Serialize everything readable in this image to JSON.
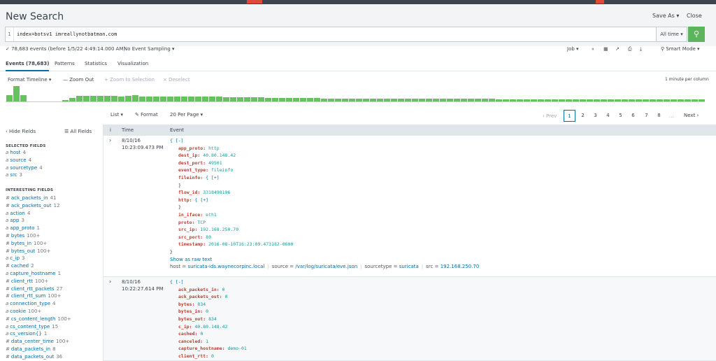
{
  "header": {
    "title": "New Search",
    "save_as": "Save As ▾",
    "close": "Close"
  },
  "search": {
    "line_number": "1",
    "query": "index=botsv1 imreallynotbatman.com",
    "time_range": "All time ▾",
    "go_icon": "search-icon"
  },
  "status": {
    "events_text": "✓ 78,683 events (before 1/5/22 4:49:14.000 AM)",
    "sampling": "No Event Sampling ▾",
    "job": "Job ▾",
    "smart_mode": "⚲ Smart Mode ▾",
    "job_icons": [
      "pause-icon",
      "stop-icon",
      "share-icon",
      "print-icon",
      "export-icon"
    ]
  },
  "tabs": [
    "Events (78,683)",
    "Patterns",
    "Statistics",
    "Visualization"
  ],
  "timeline_toolbar": {
    "format": "Format Timeline ▾",
    "zoom_out": "— Zoom Out",
    "zoom_sel": "+ Zoom to Selection",
    "deselect": "× Deselect",
    "scale": "1 minute per column"
  },
  "timeline_bars": [
    0.42,
    1.0,
    0.42,
    0.0,
    0.0,
    0.0,
    0.0,
    0.0,
    0.09,
    0.23,
    0.35,
    0.35,
    0.35,
    0.38,
    0.38,
    0.38,
    0.33,
    0.38,
    0.42,
    0.33,
    0.33,
    0.33,
    0.33,
    0.33,
    0.33,
    0.33,
    0.33,
    0.33,
    0.33,
    0.33,
    0.33,
    0.28,
    0.28,
    0.28,
    0.28,
    0.28,
    0.26,
    0.24,
    0.24,
    0.24,
    0.22,
    0.22,
    0.22,
    0.22,
    0.22,
    0.2,
    0.2,
    0.2,
    0.2,
    0.2,
    0.2,
    0.2,
    0.18,
    0.18,
    0.18,
    0.18,
    0.18,
    0.18,
    0.18,
    0.18,
    0.16,
    0.16,
    0.16,
    0.16,
    0.16,
    0.16,
    0.16,
    0.16,
    0.16,
    0.16,
    0.14,
    0.14,
    0.14,
    0.14,
    0.14,
    0.14,
    0.14,
    0.14,
    0.14,
    0.14,
    0.14,
    0.14,
    0.12,
    0.12,
    0.12,
    0.12,
    0.12,
    0.12,
    0.12,
    0.12,
    0.12,
    0.12,
    0.12,
    0.12,
    0.12,
    0.12,
    0.12,
    0.12,
    0.12,
    0.12
  ],
  "list_controls": {
    "list": "List ▾",
    "format": "✎ Format",
    "per_page": "20 Per Page ▾"
  },
  "pagination": {
    "prev": "‹ Prev",
    "pages": [
      "1",
      "2",
      "3",
      "4",
      "5",
      "6",
      "7",
      "8"
    ],
    "ellipsis": "...",
    "next": "Next ›",
    "active": "1"
  },
  "sidebar": {
    "hide_fields": "‹ Hide Fields",
    "all_fields": "☰ All Fields",
    "selected_title": "SELECTED FIELDS",
    "selected": [
      {
        "type": "a",
        "name": "host",
        "count": "4"
      },
      {
        "type": "a",
        "name": "source",
        "count": "4"
      },
      {
        "type": "a",
        "name": "sourcetype",
        "count": "4"
      },
      {
        "type": "a",
        "name": "src",
        "count": "3"
      }
    ],
    "interesting_title": "INTERESTING FIELDS",
    "interesting": [
      {
        "type": "#",
        "name": "ack_packets_in",
        "count": "41"
      },
      {
        "type": "#",
        "name": "ack_packets_out",
        "count": "12"
      },
      {
        "type": "a",
        "name": "action",
        "count": "4"
      },
      {
        "type": "a",
        "name": "app",
        "count": "3"
      },
      {
        "type": "a",
        "name": "app_proto",
        "count": "1"
      },
      {
        "type": "#",
        "name": "bytes",
        "count": "100+"
      },
      {
        "type": "#",
        "name": "bytes_in",
        "count": "100+"
      },
      {
        "type": "#",
        "name": "bytes_out",
        "count": "100+"
      },
      {
        "type": "a",
        "name": "c_ip",
        "count": "3"
      },
      {
        "type": "#",
        "name": "cached",
        "count": "2"
      },
      {
        "type": "a",
        "name": "capture_hostname",
        "count": "1"
      },
      {
        "type": "#",
        "name": "client_rtt",
        "count": "100+"
      },
      {
        "type": "#",
        "name": "client_rtt_packets",
        "count": "27"
      },
      {
        "type": "#",
        "name": "client_rtt_sum",
        "count": "100+"
      },
      {
        "type": "a",
        "name": "connection_type",
        "count": "4"
      },
      {
        "type": "a",
        "name": "cookie",
        "count": "100+"
      },
      {
        "type": "#",
        "name": "cs_content_length",
        "count": "100+"
      },
      {
        "type": "a",
        "name": "cs_content_type",
        "count": "15"
      },
      {
        "type": "a",
        "name": "cs_version{}",
        "count": "1"
      },
      {
        "type": "#",
        "name": "data_center_time",
        "count": "100+"
      },
      {
        "type": "#",
        "name": "data_packets_in",
        "count": "8"
      },
      {
        "type": "#",
        "name": "data_packets_out",
        "count": "36"
      }
    ]
  },
  "events_header": {
    "info": "i",
    "time": "Time",
    "event": "Event"
  },
  "events": [
    {
      "date": "8/10/16",
      "time": "10:23:09.473 PM",
      "open": "{ [-]",
      "lines": [
        {
          "indent": 1,
          "key": "app_proto:",
          "val": "http"
        },
        {
          "indent": 1,
          "key": "dest_ip:",
          "val": "40.80.148.42"
        },
        {
          "indent": 1,
          "key": "dest_port:",
          "val": "49501"
        },
        {
          "indent": 1,
          "key": "event_type:",
          "val": "fileinfo"
        },
        {
          "indent": 1,
          "key": "fileinfo:",
          "val": "{ [+]",
          "link": true
        },
        {
          "indent": 1,
          "key": "",
          "val": "}",
          "plain": true
        },
        {
          "indent": 1,
          "key": "flow_id:",
          "val": "3318498196"
        },
        {
          "indent": 1,
          "key": "http:",
          "val": "{ [+]",
          "link": true
        },
        {
          "indent": 1,
          "key": "",
          "val": "}",
          "plain": true
        },
        {
          "indent": 1,
          "key": "in_iface:",
          "val": "eth1"
        },
        {
          "indent": 1,
          "key": "proto:",
          "val": "TCP"
        },
        {
          "indent": 1,
          "key": "src_ip:",
          "val": "192.168.250.70"
        },
        {
          "indent": 1,
          "key": "src_port:",
          "val": "80"
        },
        {
          "indent": 1,
          "key": "timestamp:",
          "val": "2016-08-10T16:23:09.473182-0600"
        }
      ],
      "close": "}",
      "show_raw": "Show as raw text",
      "meta": [
        {
          "k": "host = ",
          "v": "suricata-ids.waynecorpinc.local"
        },
        {
          "k": "source = ",
          "v": "/var/log/suricata/eve.json"
        },
        {
          "k": "sourcetype = ",
          "v": "suricata"
        },
        {
          "k": "src = ",
          "v": "192.168.250.70"
        }
      ]
    },
    {
      "date": "8/10/16",
      "time": "10:22:27.614 PM",
      "open": "{ [-]",
      "lines": [
        {
          "indent": 1,
          "key": "ack_packets_in:",
          "val": "0"
        },
        {
          "indent": 1,
          "key": "ack_packets_out:",
          "val": "0"
        },
        {
          "indent": 1,
          "key": "bytes:",
          "val": "834"
        },
        {
          "indent": 1,
          "key": "bytes_in:",
          "val": "0"
        },
        {
          "indent": 1,
          "key": "bytes_out:",
          "val": "834"
        },
        {
          "indent": 1,
          "key": "c_ip:",
          "val": "40.80.148.42"
        },
        {
          "indent": 1,
          "key": "cached:",
          "val": "0"
        },
        {
          "indent": 1,
          "key": "canceled:",
          "val": "1"
        },
        {
          "indent": 1,
          "key": "capture_hostname:",
          "val": "demo-01"
        },
        {
          "indent": 1,
          "key": "client_rtt:",
          "val": "0"
        }
      ]
    }
  ]
}
